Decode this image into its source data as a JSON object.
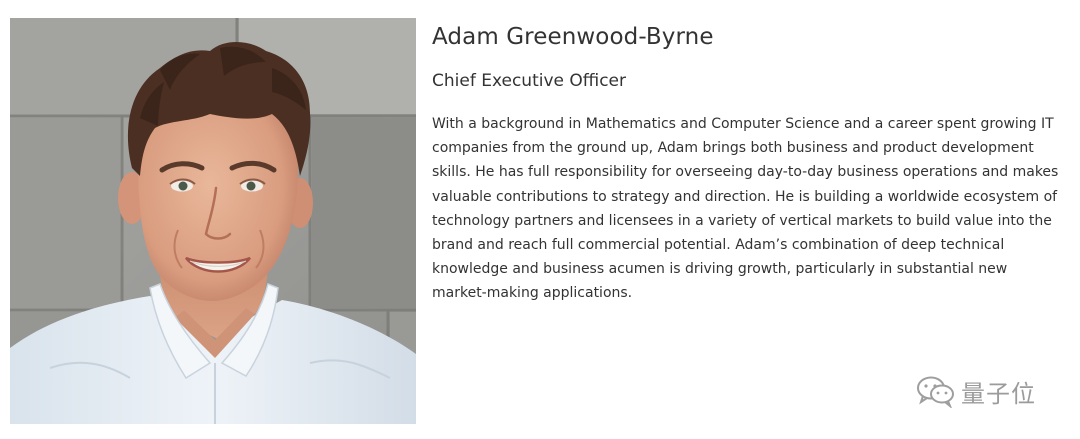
{
  "profile": {
    "name": "Adam Greenwood-Byrne",
    "title": "Chief Executive Officer",
    "bio": "With a background in Mathematics and Computer Science and a career spent growing IT companies from the ground up, Adam brings both business and product development skills. He has full responsibility for overseeing day-to-day business operations and makes valuable contributions to strategy and direction. He is building a worldwide ecosystem of technology partners and licensees in a variety of vertical markets to build value into the brand and reach full commercial potential. Adam’s combination of deep technical knowledge and business acumen is driving growth, particularly in substantial new market-making applications.",
    "photo_icon": "portrait-photo"
  },
  "watermark": {
    "text": "量子位",
    "icon": "wechat-logo-icon"
  },
  "colors": {
    "text": "#333333",
    "background": "#ffffff",
    "wall": "#9c9c9a",
    "shirt": "#e4ecf3"
  }
}
